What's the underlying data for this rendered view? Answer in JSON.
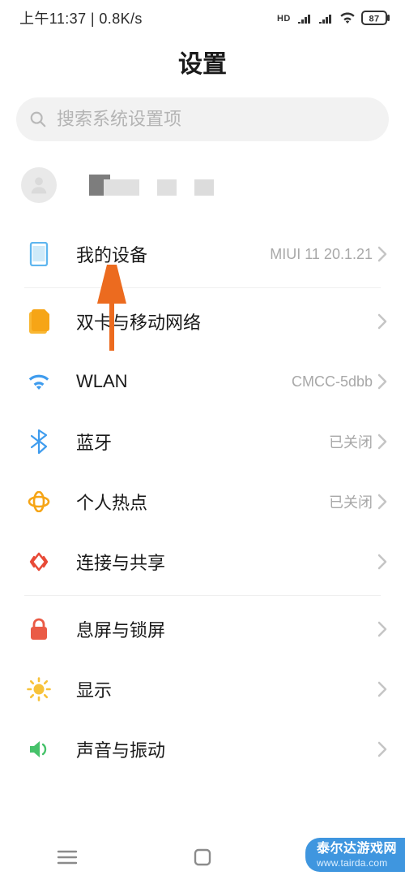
{
  "status": {
    "left": "上午11:37 | 0.8K/s",
    "battery_pct": "87"
  },
  "title": "设置",
  "search": {
    "placeholder": "搜索系统设置项"
  },
  "rows": {
    "device": {
      "label": "我的设备",
      "value": "MIUI 11 20.1.21"
    },
    "sim": {
      "label": "双卡与移动网络",
      "value": ""
    },
    "wlan": {
      "label": "WLAN",
      "value": "CMCC-5dbb"
    },
    "bt": {
      "label": "蓝牙",
      "value": "已关闭"
    },
    "hotspot": {
      "label": "个人热点",
      "value": "已关闭"
    },
    "share": {
      "label": "连接与共享",
      "value": ""
    },
    "lock": {
      "label": "息屏与锁屏",
      "value": ""
    },
    "display": {
      "label": "显示",
      "value": ""
    },
    "sound": {
      "label": "声音与振动",
      "value": ""
    }
  },
  "watermark": {
    "title": "泰尔达游戏网",
    "url": "www.tairda.com"
  }
}
